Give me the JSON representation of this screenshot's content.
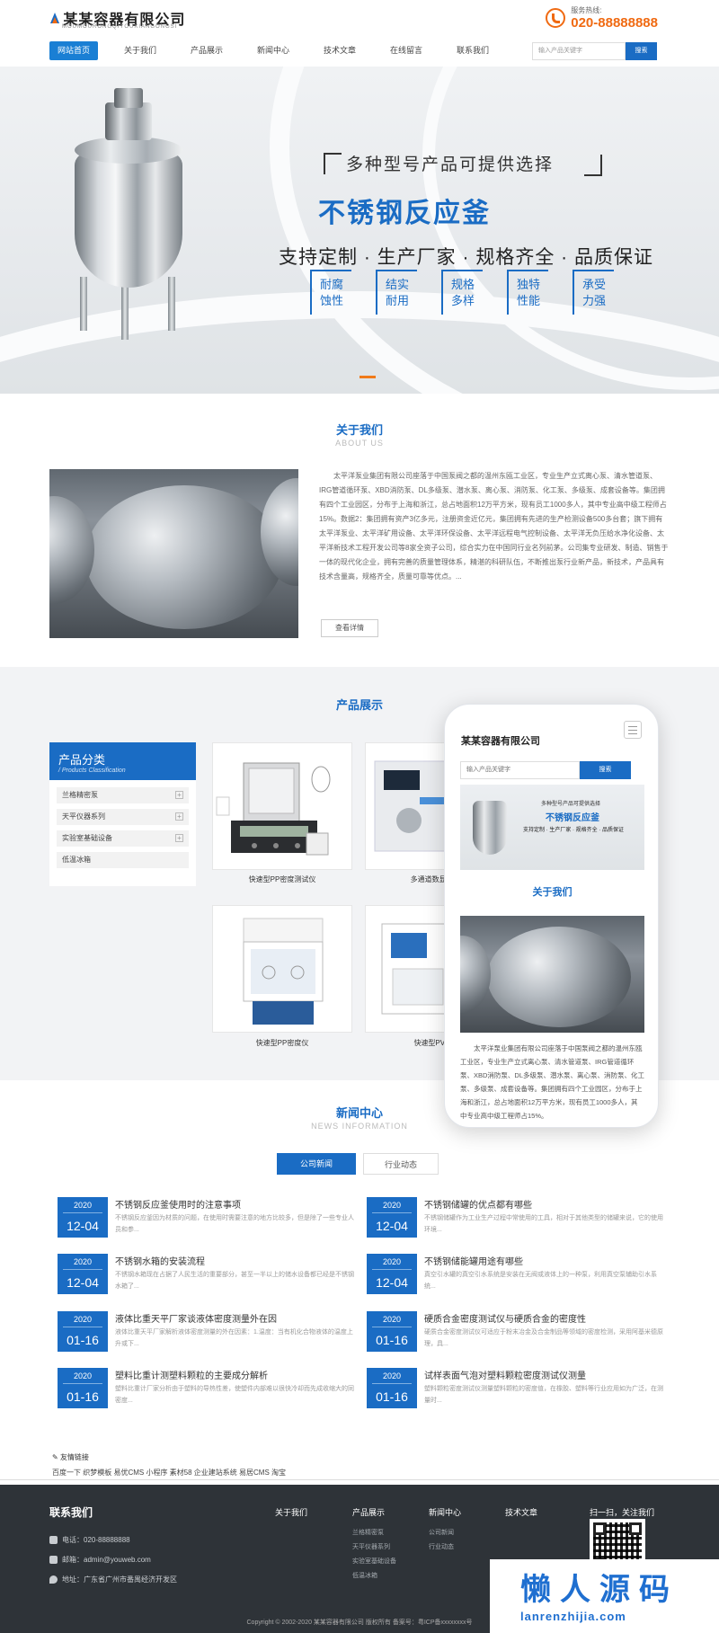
{
  "header": {
    "logo_cn": "某某容器有限公司",
    "logo_py": "MOUMOURONGQIYOUXIANGONGSI",
    "hotline_label": "服务热线:",
    "hotline_number": "020-88888888"
  },
  "nav": {
    "items": [
      "网站首页",
      "关于我们",
      "产品展示",
      "新闻中心",
      "技术文章",
      "在线留言",
      "联系我们"
    ],
    "search_placeholder": "输入产品关键字",
    "search_button": "搜索"
  },
  "banner": {
    "subtitle": "多种型号产品可提供选择",
    "title": "不锈钢反应釜",
    "tagline": "支持定制 · 生产厂家 · 规格齐全 · 品质保证",
    "features": [
      {
        "l1": "耐腐",
        "l2": "蚀性"
      },
      {
        "l1": "结实",
        "l2": "耐用"
      },
      {
        "l1": "规格",
        "l2": "多样"
      },
      {
        "l1": "独特",
        "l2": "性能"
      },
      {
        "l1": "承受",
        "l2": "力强"
      }
    ]
  },
  "about": {
    "title": "关于我们",
    "title_en": "ABOUT US",
    "text": "太平洋泵业集团有限公司座落于中国泵阀之都的温州东瓯工业区，专业生产立式离心泵、清水管道泵、IRG管道循环泵、XBD消防泵、DL多级泵、潜水泵、离心泵、消防泵、化工泵、多级泵、成套设备等。集团拥有四个工业园区，分布于上海和浙江，总占地面积12万平方米，现有员工1000多人，其中专业高中级工程师占15%。数据2：集团拥有资产3亿多元，注册资金近亿元，集团拥有先进的生产检测设备500多台套；旗下拥有太平洋泵业、太平洋矿用设备、太平洋环保设备、太平洋远程电气控制设备、太平洋无负压给水净化设备、太平洋新技术工程开发公司等8家全资子公司，综合实力在中国同行业名列前茅。公司集专业研发、制造、销售于一体的现代化企业，拥有完善的质量管理体系，精湛的科研队伍，不断推出泵行业新产品，新技术，产品具有技术含量高，规格齐全，质量可靠等优点。...",
    "more": "查看详情"
  },
  "products": {
    "title": "产品展示",
    "category_title": "产品分类",
    "category_title_en": "/ Products Classification",
    "categories": [
      "兰格精密泵",
      "天平仪器系列",
      "实验室基础设备",
      "低温冰箱"
    ],
    "items": [
      {
        "name": "快速型PP密度测试仪"
      },
      {
        "name": "多通道数显型..."
      },
      {
        "name": "快速型PP密度仪"
      },
      {
        "name": "快速型PVC..."
      }
    ]
  },
  "phone": {
    "logo": "某某容器有限公司",
    "search_placeholder": "输入产品关键字",
    "search_button": "搜索",
    "banner_sub": "多种型号产品可提供选择",
    "banner_title": "不锈钢反应釜",
    "banner_tag": "支持定制 · 生产厂家 · 规格齐全 · 品质保证",
    "about_title": "关于我们",
    "about_text": "太平洋泵业集团有限公司座落于中国泵阀之都的温州东瓯工业区，专业生产立式离心泵、清水管道泵、IRG管道循环泵、XBD消防泵、DL多级泵、潜水泵、离心泵、消防泵、化工泵、多级泵、成套设备等。集团拥有四个工业园区，分布于上海和浙江，总占地面积12万平方米，现有员工1000多人，其中专业高中级工程师占15%。"
  },
  "news": {
    "title": "新闻中心",
    "title_en": "NEWS INFORMATION",
    "tabs": [
      "公司新闻",
      "行业动态"
    ],
    "items": [
      {
        "year": "2020",
        "day": "12-04",
        "title": "不锈钢反应釜使用时的注意事项",
        "desc": "不锈钢反应釜因为材质的问题，在使用时需要注意的地方比较多，但是除了一些专业人员和参..."
      },
      {
        "year": "2020",
        "day": "12-04",
        "title": "不锈钢储罐的优点都有哪些",
        "desc": "不锈钢储罐作为工业生产过程中常使用的工具，相对于其他类型的储罐来说，它的使用环境..."
      },
      {
        "year": "2020",
        "day": "12-04",
        "title": "不锈钢水箱的安装流程",
        "desc": "不锈钢水箱现在占据了人民生活的重要部分，甚至一半以上的储水设备都已经是不锈钢水箱了..."
      },
      {
        "year": "2020",
        "day": "12-04",
        "title": "不锈钢储能罐用途有哪些",
        "desc": "真空引水罐的真空引水系统是安装在无阀或液体上的一种泵，利用真空泵辅助引水系统..."
      },
      {
        "year": "2020",
        "day": "01-16",
        "title": "液体比重天平厂家谈液体密度测量外在因",
        "desc": "液体比重天平厂家解析液体密度测量的外在因素：1.温度：当有机化合物液体的温度上升或下..."
      },
      {
        "year": "2020",
        "day": "01-16",
        "title": "硬质合金密度测试仪与硬质合金的密度性",
        "desc": "硬质合金密度测试仪可适应于粉末冶金及合金制品等领域的密度检测，采用阿基米德原理，具..."
      },
      {
        "year": "2020",
        "day": "01-16",
        "title": "塑料比重计测塑料颗粒的主要成分解析",
        "desc": "塑料比重计厂家分析由于塑料的导热性差，使塑件内部难以很快冷却而先成收缩大的同密度..."
      },
      {
        "year": "2020",
        "day": "01-16",
        "title": "试样表面气泡对塑料颗粒密度测试仪测量",
        "desc": "塑料颗粒密度测试仪测量塑料颗粒的密度值，在橡胶、塑料等行业应用如为广泛，在测量时..."
      }
    ]
  },
  "links": {
    "title": "友情链接",
    "items": "百度一下 织梦模板 易优CMS 小程序 素材58 企业建站系统 易居CMS 淘宝"
  },
  "footer": {
    "contact_title": "联系我们",
    "phone": "电话：020-88888888",
    "email": "邮箱：admin@youweb.com",
    "address": "地址：广东省广州市番禺经济开发区",
    "cols": [
      {
        "title": "关于我们",
        "items": []
      },
      {
        "title": "产品展示",
        "items": [
          "兰格精密泵",
          "天平仪器系列",
          "实验室基础设备",
          "低温冰箱"
        ]
      },
      {
        "title": "新闻中心",
        "items": [
          "公司新闻",
          "行业动态"
        ]
      },
      {
        "title": "技术文章",
        "items": []
      }
    ],
    "qr_title": "扫一扫，关注我们",
    "copyright": "Copyright © 2002-2020 某某容器有限公司 版权所有    备案号：粤ICP备xxxxxxxx号"
  },
  "watermark": {
    "cn": "懒人源码",
    "en": "lanrenzhijia.com"
  },
  "colors": {
    "primary": "#1a6cc4",
    "accent": "#f06a12",
    "footer": "#2e3338"
  }
}
